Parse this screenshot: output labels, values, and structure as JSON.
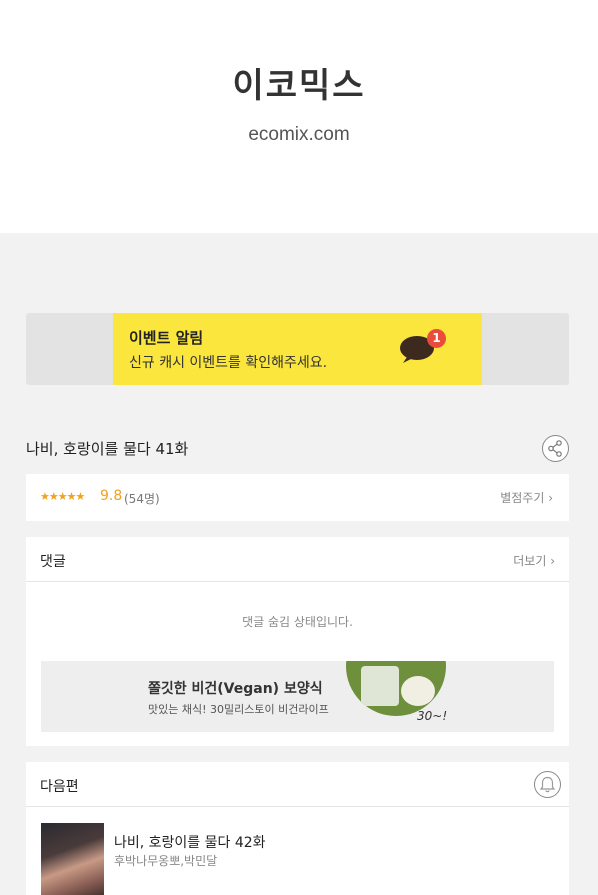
{
  "header": {
    "logo": "이코믹스",
    "domain": "ecomix.com"
  },
  "event_banner": {
    "title": "이벤트 알림",
    "description": "신규 캐시 이벤트를 확인해주세요.",
    "badge_count": "1"
  },
  "episode": {
    "title": "나비, 호랑이를 물다 41화"
  },
  "rating": {
    "stars": "★★★★★",
    "score": "9.8",
    "count": "(54명)",
    "rate_link": "별점주기 ›"
  },
  "comments": {
    "title": "댓글",
    "more": "더보기 ›",
    "hidden_message": "댓글 숨김 상태입니다."
  },
  "ad": {
    "title": "쫄깃한 비건(Vegan) 보양식",
    "description": "맛있는 채식! 30밀리스토이 비건라이프",
    "brand_mark": "30~!"
  },
  "next_episode": {
    "section_title": "다음편",
    "title": "나비, 호랑이를 물다 42화",
    "author": "후박나무옹뽀,박민달"
  },
  "colors": {
    "banner_yellow": "#fae63c",
    "rating_orange": "#f0a21b",
    "badge_red": "#e94b3c"
  }
}
